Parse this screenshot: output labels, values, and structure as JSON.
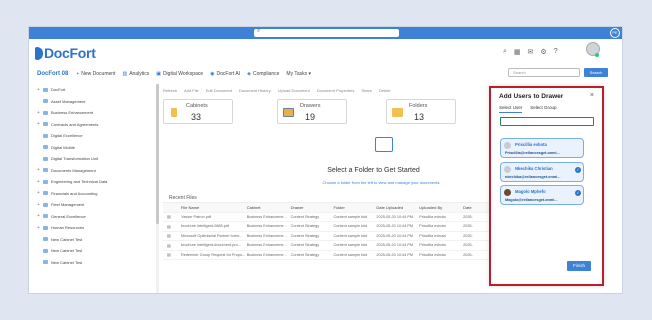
{
  "topbar": {
    "search_placeholder": "",
    "avatar": "PE"
  },
  "header": {
    "logo": "DocFort"
  },
  "nav": {
    "brand": "DocFort 08",
    "items": [
      "New Document",
      "Analytics",
      "Digital Workspace",
      "DocFort AI",
      "Compliance",
      "My Tasks"
    ],
    "search_placeholder": "Search",
    "search_button": "Search"
  },
  "sidebar": {
    "items": [
      {
        "label": "DocFort",
        "plus": true
      },
      {
        "label": "Asset Management",
        "plus": false
      },
      {
        "label": "Business Enhancement",
        "plus": true
      },
      {
        "label": "Contracts and Agreements",
        "plus": true
      },
      {
        "label": "Digital Excellence",
        "plus": false
      },
      {
        "label": "Digital Mobile",
        "plus": false
      },
      {
        "label": "Digital Transformation Unit",
        "plus": false
      },
      {
        "label": "Documents Management",
        "plus": true
      },
      {
        "label": "Engineering and Technical Data",
        "plus": true
      },
      {
        "label": "Financials and Accounting",
        "plus": true
      },
      {
        "label": "Fleet Management",
        "plus": true
      },
      {
        "label": "General Excellence",
        "plus": true
      },
      {
        "label": "Human Resources",
        "plus": true
      },
      {
        "label": "New Cabinet Test",
        "plus": false
      },
      {
        "label": "New Cabinet Test",
        "plus": false
      },
      {
        "label": "New Cabinet Test",
        "plus": false
      }
    ]
  },
  "toolbar": [
    "Refresh",
    "Add File",
    "Edit Document",
    "Document History",
    "Upload Document",
    "Document Properties",
    "Share",
    "Delete"
  ],
  "cards": [
    {
      "title": "Cabinets",
      "count": "33"
    },
    {
      "title": "Drawers",
      "count": "19"
    },
    {
      "title": "Folders",
      "count": "13"
    }
  ],
  "main": {
    "select_title": "Select a Folder to Get Started",
    "select_sub": "Choose a folder from the left to view and manage your documents."
  },
  "recent": {
    "title": "Recent Files",
    "headers": [
      "File Name",
      "Cabinet",
      "Drawer",
      "Folder",
      "Date Uploaded",
      "Uploaded By",
      "Date"
    ],
    "rows": [
      [
        "Yasser Patron.pdf",
        "Business Enhanceme...",
        "Content Strategy",
        "Content sample fold",
        "2025-05-20 10:44 PM",
        "Priscillia evbota",
        "2025-"
      ],
      [
        "brochure intelligent-0885.pdf",
        "Business Enhanceme...",
        "Content Strategy",
        "Content sample fold",
        "2025-05-20 10:44 PM",
        "Priscillia evbota",
        "2025-"
      ],
      [
        "Microsoft Optimiscial Partner foren...",
        "Business Enhanceme...",
        "Content Strategy",
        "Content sample fold",
        "2025-05-20 10:44 PM",
        "Priscillia evbota",
        "2025-"
      ],
      [
        "brochure intelligent-document-pro...",
        "Business Enhanceme...",
        "Content Strategy",
        "Content sample fold",
        "2025-05-20 10:44 PM",
        "Priscillia evbota",
        "2025-"
      ],
      [
        "Redeemer Group Request for Propo...",
        "Business Enhanceme...",
        "Content Strategy",
        "Content sample fold",
        "2025-05-20 10:44 PM",
        "Priscillia evbota",
        "2025-"
      ]
    ]
  },
  "dialog": {
    "title": "Add Users to Drawer",
    "close": "×",
    "tabs": [
      "Select User",
      "Select Group"
    ],
    "input_value": "",
    "users": [
      {
        "name": "Priscillia evbota",
        "email": "Priscillia@rellancesget.onmi...",
        "checked": false
      },
      {
        "name": "Nkechika Christian",
        "email": "nkechika@rellancesget.onmi...",
        "checked": true
      },
      {
        "name": "Magolo Mphefo",
        "email": "Magolo@rellancesget.onmi...",
        "checked": true
      }
    ],
    "finish": "Finish"
  }
}
